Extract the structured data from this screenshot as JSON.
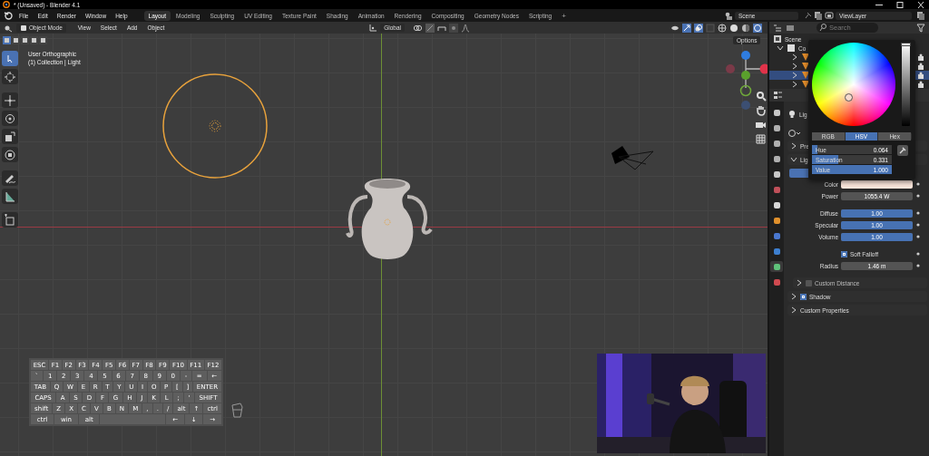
{
  "window": {
    "title": "* (Unsaved) - Blender 4.1"
  },
  "menu": [
    "File",
    "Edit",
    "Render",
    "Window",
    "Help"
  ],
  "workspaces": [
    {
      "label": "Layout",
      "selected": true
    },
    {
      "label": "Modeling",
      "selected": false
    },
    {
      "label": "Sculpting",
      "selected": false
    },
    {
      "label": "UV Editing",
      "selected": false
    },
    {
      "label": "Texture Paint",
      "selected": false
    },
    {
      "label": "Shading",
      "selected": false
    },
    {
      "label": "Animation",
      "selected": false
    },
    {
      "label": "Rendering",
      "selected": false
    },
    {
      "label": "Compositing",
      "selected": false
    },
    {
      "label": "Geometry Nodes",
      "selected": false
    },
    {
      "label": "Scripting",
      "selected": false
    }
  ],
  "add_workspace": "+",
  "scene": "Scene",
  "view_layer": "ViewLayer",
  "viewport_header": {
    "mode": "Object Mode",
    "menus": [
      "View",
      "Select",
      "Add",
      "Object"
    ],
    "orientation": "Global",
    "options": "Options"
  },
  "viewport": {
    "overlay_lines": [
      "User Orthographic",
      "(1) Collection | Light"
    ],
    "keyboard": {
      "key_rows": [
        {
          "keys": [
            "ESC",
            "F1",
            "F2",
            "F3",
            "F4",
            "F5",
            "F6",
            "F7",
            "F8",
            "F9",
            "F10",
            "F11",
            "F12"
          ]
        },
        {
          "keys": [
            "`",
            "1",
            "2",
            "3",
            "4",
            "5",
            "6",
            "7",
            "8",
            "9",
            "0",
            "-",
            "=",
            "←"
          ]
        },
        {
          "keys": [
            "TAB",
            "Q",
            "W",
            "E",
            "R",
            "T",
            "Y",
            "U",
            "I",
            "O",
            "P",
            "[",
            "]",
            "ENTER"
          ]
        },
        {
          "keys": [
            "CAPS",
            "A",
            "S",
            "D",
            "F",
            "G",
            "H",
            "J",
            "K",
            "L",
            ";",
            "'",
            "SHIFT"
          ]
        },
        {
          "keys": [
            "shift",
            "Z",
            "X",
            "C",
            "V",
            "B",
            "N",
            "M",
            ",",
            ".",
            "/",
            "alt",
            "↑",
            "ctrl"
          ]
        },
        {
          "keys": [
            "ctrl",
            "win",
            "alt"
          ],
          "space": true,
          "keys_after": [
            "←",
            "↓",
            "→"
          ]
        }
      ]
    }
  },
  "outliner": {
    "search": {
      "placeholder": "Search"
    },
    "root": "Scene",
    "rows": [
      {
        "label": "Co",
        "selected": false,
        "children": [
          {
            "selected": false
          },
          {
            "selected": false
          },
          {
            "selected": true
          },
          {
            "selected": false
          }
        ]
      }
    ]
  },
  "properties": {
    "tabs": [
      {
        "selected": false,
        "color": "#c8c8c8"
      },
      {
        "selected": false,
        "color": "#b0b0b0"
      },
      {
        "selected": false,
        "color": "#b0b0b0"
      },
      {
        "selected": false,
        "color": "#b0b0b0"
      },
      {
        "selected": false,
        "color": "#c8c8c8"
      },
      {
        "selected": false,
        "color": "#c0505a"
      },
      {
        "selected": false,
        "color": "#d8d8d8"
      },
      {
        "selected": false,
        "color": "#e0902c"
      },
      {
        "selected": false,
        "color": "#4a78d0"
      },
      {
        "selected": false,
        "color": "#3d7fd0"
      },
      {
        "selected": true,
        "color": "#5fc27a"
      },
      {
        "selected": false,
        "color": "#d04a50"
      }
    ],
    "data_name": "Lig",
    "top_panels": [
      {
        "label": "Pre",
        "expanded": false
      },
      {
        "label": "Lig",
        "expanded": true
      }
    ],
    "rows": [
      {
        "kind": "color",
        "label": "Color",
        "color": "#fbe6dc"
      },
      {
        "kind": "value",
        "label": "Power",
        "value": "1055.4 W"
      },
      {
        "kind": "slider",
        "label": "Diffuse",
        "value": "1.00",
        "level": 1.0
      },
      {
        "kind": "slider",
        "label": "Specular",
        "value": "1.00",
        "level": 1.0
      },
      {
        "kind": "slider",
        "label": "Volume",
        "value": "1.00",
        "level": 1.0
      },
      {
        "kind": "checkbox",
        "label": "Soft Falloff",
        "checked": true
      },
      {
        "kind": "value",
        "label": "Radius",
        "value": "1.46 m"
      }
    ],
    "panels": [
      {
        "kind": "subpanel",
        "label": "Custom Distance",
        "expanded": false,
        "checked": false
      },
      {
        "kind": "panel",
        "label": "Shadow",
        "expanded": false,
        "checked": true
      },
      {
        "kind": "panel",
        "label": "Custom Properties",
        "expanded": false
      }
    ]
  },
  "color_picker": {
    "modes": [
      {
        "label": "RGB",
        "selected": false
      },
      {
        "label": "HSV",
        "selected": true
      },
      {
        "label": "Hex",
        "selected": false
      }
    ],
    "fields": [
      {
        "label": "Hue",
        "value": "0.064",
        "level": 0.064
      },
      {
        "label": "Saturation",
        "value": "0.331",
        "level": 0.331
      },
      {
        "label": "Value",
        "value": "1.000",
        "level": 1.0
      }
    ]
  }
}
